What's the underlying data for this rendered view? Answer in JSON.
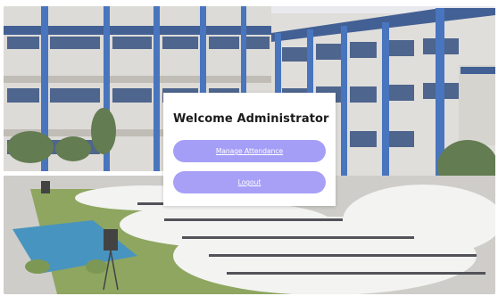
{
  "page": {
    "background_description_color": "#ffffff"
  },
  "dialog": {
    "title": "Welcome Administrator",
    "buttons": {
      "manage_attendance": "Manage Attendance",
      "logout": "Logout"
    }
  },
  "colors": {
    "button_accent": "#a59ef7",
    "card_background": "#ffffff",
    "title_text": "#1b1b1b",
    "button_text": "#ffffff"
  }
}
